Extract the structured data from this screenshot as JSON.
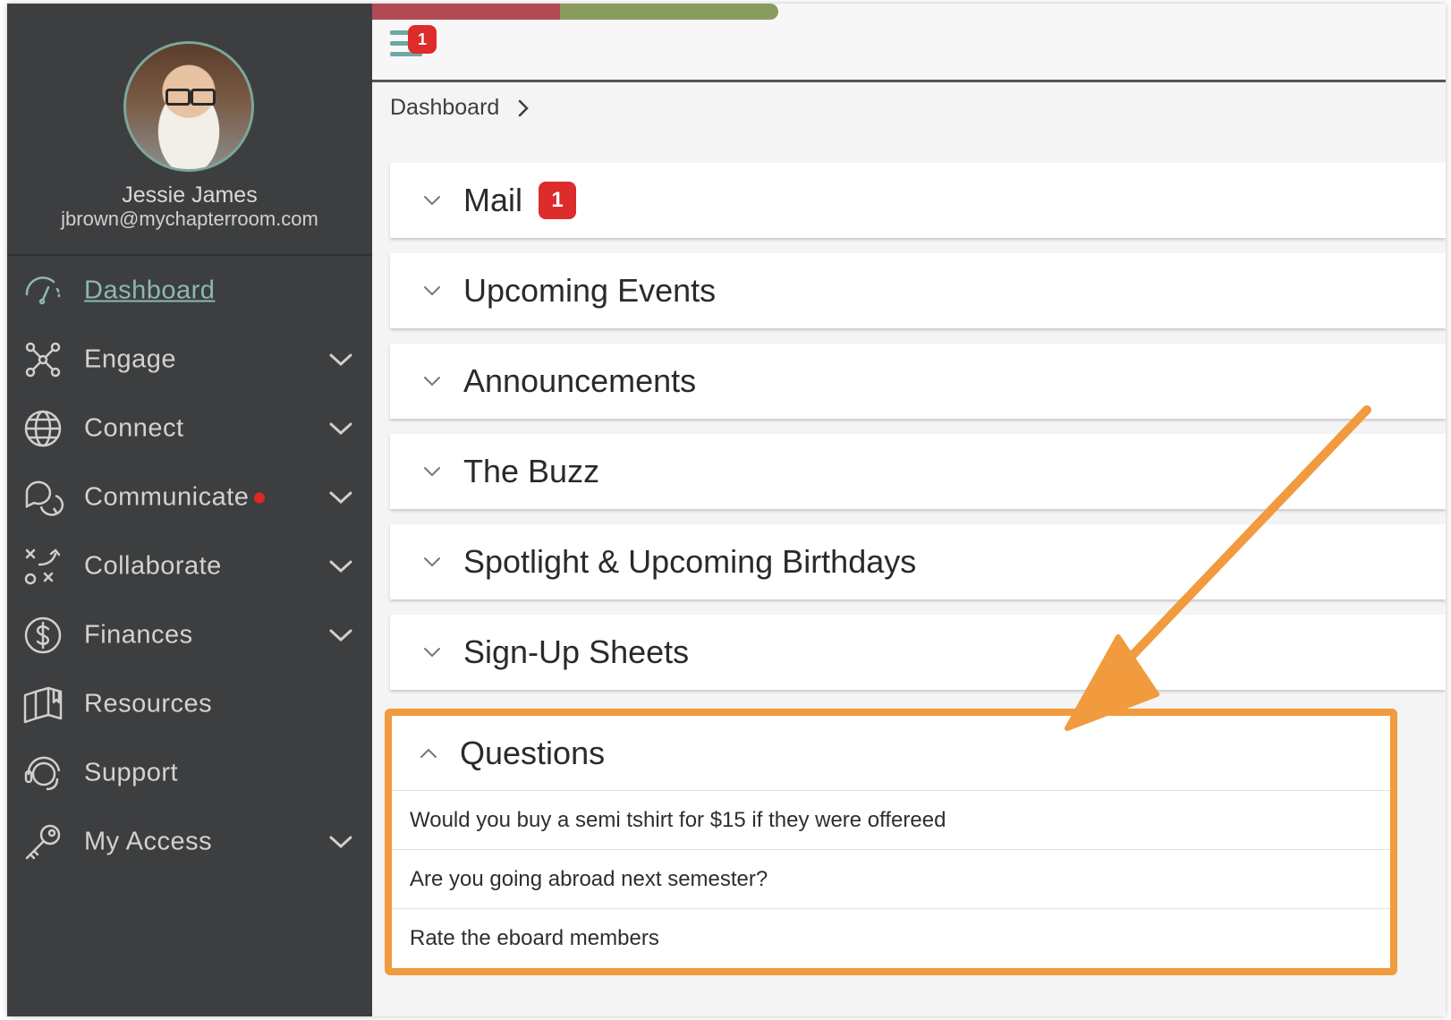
{
  "user": {
    "name": "Jessie James",
    "email": "jbrown@mychapterroom.com"
  },
  "topbar": {
    "menu_badge": "1",
    "progress": {
      "red_color": "#b24a55",
      "green_color": "#8a9b5e"
    }
  },
  "breadcrumb": {
    "current": "Dashboard"
  },
  "nav": {
    "items": [
      {
        "label": "Dashboard",
        "icon": "speedometer-icon",
        "active": true
      },
      {
        "label": "Engage",
        "icon": "network-icon",
        "expandable": true
      },
      {
        "label": "Connect",
        "icon": "globe-icon",
        "expandable": true
      },
      {
        "label": "Communicate",
        "icon": "chat-bubbles-icon",
        "expandable": true,
        "notification_dot": true
      },
      {
        "label": "Collaborate",
        "icon": "strategy-icon",
        "expandable": true
      },
      {
        "label": "Finances",
        "icon": "dollar-icon",
        "expandable": true
      },
      {
        "label": "Resources",
        "icon": "book-icon"
      },
      {
        "label": "Support",
        "icon": "headset-icon"
      },
      {
        "label": "My Access",
        "icon": "key-icon",
        "expandable": true
      }
    ]
  },
  "panels": [
    {
      "title": "Mail",
      "badge": "1"
    },
    {
      "title": "Upcoming Events"
    },
    {
      "title": "Announcements"
    },
    {
      "title": "The Buzz"
    },
    {
      "title": "Spotlight & Upcoming Birthdays"
    },
    {
      "title": "Sign-Up Sheets"
    }
  ],
  "questions": {
    "title": "Questions",
    "expanded": true,
    "items": [
      "Would you buy a semi tshirt for $15 if they were offereed",
      "Are you going abroad next semester?",
      "Rate the eboard members"
    ]
  },
  "colors": {
    "sidebar_bg": "#3d3e40",
    "accent_teal": "#8cb8b4",
    "badge_red": "#dd2c2c",
    "highlight_orange": "#f19a3e"
  }
}
